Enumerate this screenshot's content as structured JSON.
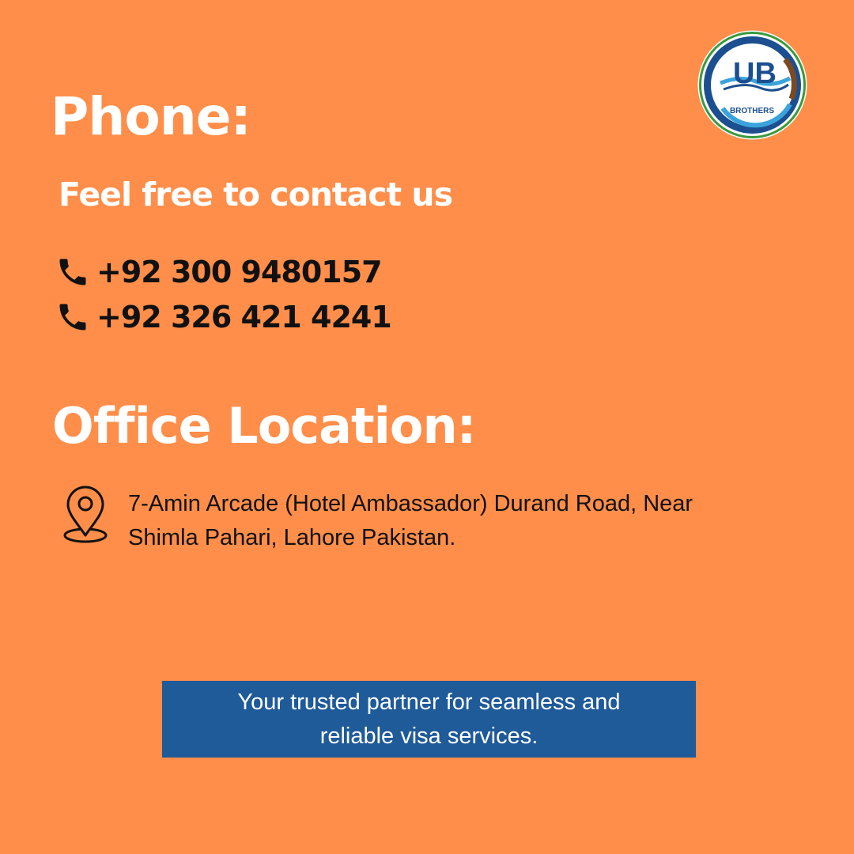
{
  "logo": {
    "monogram": "UB",
    "text": "BROTHERS",
    "colors": {
      "ring": "#1B4F8F",
      "accent": "#3BA3DB",
      "green": "#3A9A3F",
      "brown": "#7A4A22"
    }
  },
  "phone": {
    "heading": "Phone:",
    "subheading": "Feel free to contact us",
    "numbers": [
      {
        "icon": "phone-icon",
        "number": "+92 300 9480157"
      },
      {
        "icon": "phone-icon",
        "number": "+92 326 421 4241"
      }
    ]
  },
  "office": {
    "heading": "Office Location:",
    "icon": "location-pin-icon",
    "address_line1": "7-Amin Arcade (Hotel Ambassador) Durand Road, Near",
    "address_line2": "Shimla Pahari, Lahore Pakistan."
  },
  "tagline": {
    "line1": "Your trusted partner for seamless and",
    "line2": "reliable visa services."
  },
  "colors": {
    "background": "#FF8E4A",
    "tagline_box": "#1F5A99",
    "heading_text": "#FFFFFF",
    "body_text": "#111111"
  }
}
